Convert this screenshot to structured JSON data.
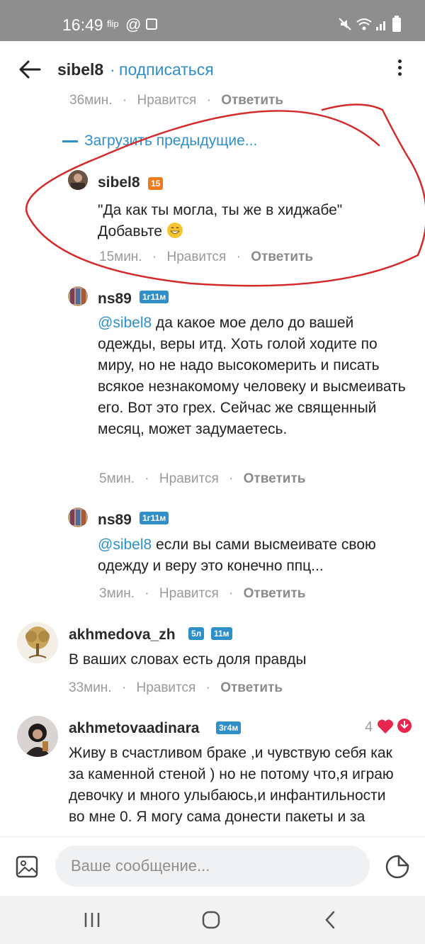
{
  "status_bar": {
    "time": "16:49",
    "flip": "flip",
    "at": "@"
  },
  "header": {
    "title": "sibel8",
    "separator": "·",
    "subscribe": "подписаться"
  },
  "top_meta": {
    "time": "36мин.",
    "like": "Нравится",
    "reply": "Ответить"
  },
  "load_previous": "Загрузить предыдущие...",
  "comments": [
    {
      "user": "sibel8",
      "badge": "15",
      "text_line1": "\"Да как ты могла, ты же в хиджабе\"",
      "text_line2": "Добавьте",
      "time": "15мин.",
      "like": "Нравится",
      "reply": "Ответить"
    },
    {
      "user": "ns89",
      "badge": "1г11м",
      "mention": "@sibel8",
      "text": " да какое мое дело до вашей одежды, веры итд. Хоть голой ходите по миру, но не надо высокомерить и писать всякое незнакомому человеку и высмеивать его. Вот это грех. Сейчас же священный месяц, может задумаетесь.",
      "time": "5мин.",
      "like": "Нравится",
      "reply": "Ответить"
    },
    {
      "user": "ns89",
      "badge": "1г11м",
      "mention": "@sibel8",
      "text": " если вы сами высмеивате свою одежду и веру это конечно ппц...",
      "time": "3мин.",
      "like": "Нравится",
      "reply": "Ответить"
    },
    {
      "user": "akhmedova_zh",
      "badge1": "5л",
      "badge2": "11м",
      "text": "В ваших словах есть доля правды",
      "time": "33мин.",
      "like": "Нравится",
      "reply": "Ответить"
    },
    {
      "user": "akhmetovaadinara",
      "badge": "3г4м",
      "likes": "4",
      "text": "Живу в счастливом браке ,и чувствую себя как за каменной стеной ) но не потому что,я играю девочку и много улыбаюсь,и инфантильности во мне 0. Я могу сама донести пакеты и за"
    }
  ],
  "meta_separator": "·",
  "composer": {
    "placeholder": "Ваше сообщение..."
  },
  "colors": {
    "accent": "#2f8fc9",
    "badge_orange": "#f07b1c",
    "annotation": "#d42a2a",
    "heart": "#e8254e"
  }
}
